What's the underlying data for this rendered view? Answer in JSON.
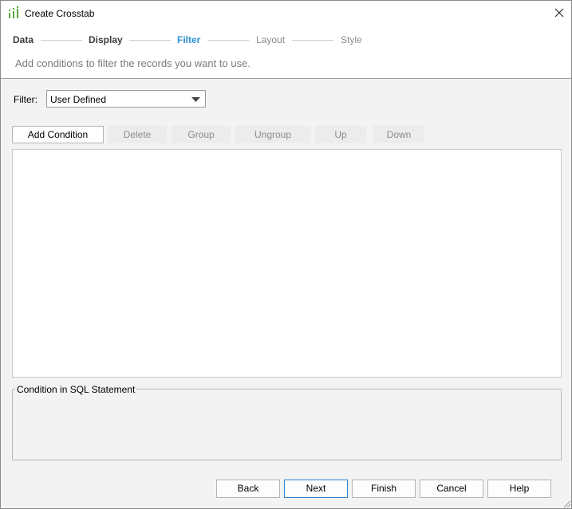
{
  "window": {
    "title": "Create Crosstab"
  },
  "steps": [
    {
      "label": "Data",
      "state": "done"
    },
    {
      "label": "Display",
      "state": "done"
    },
    {
      "label": "Filter",
      "state": "active"
    },
    {
      "label": "Layout",
      "state": "future"
    },
    {
      "label": "Style",
      "state": "future"
    }
  ],
  "subtitle": "Add conditions to filter the records you want to use.",
  "filter": {
    "label": "Filter:",
    "selected": "User Defined"
  },
  "toolbar": {
    "add_condition": "Add Condition",
    "delete": "Delete",
    "group": "Group",
    "ungroup": "Ungroup",
    "up": "Up",
    "down": "Down"
  },
  "sql": {
    "legend": "Condition in SQL Statement",
    "statement": ""
  },
  "buttons": {
    "back": "Back",
    "next": "Next",
    "finish": "Finish",
    "cancel": "Cancel",
    "help": "Help"
  },
  "colors": {
    "active_step": "#2f92d3",
    "default_button_border": "#2f82d0"
  }
}
